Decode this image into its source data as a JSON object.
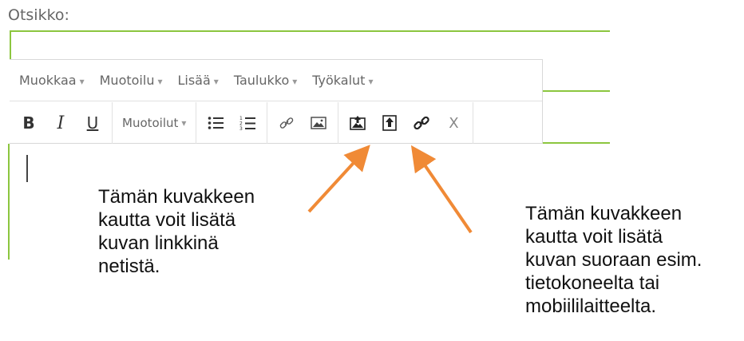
{
  "form": {
    "title_label": "Otsikko:"
  },
  "menubar": {
    "items": [
      {
        "label": "Muokkaa"
      },
      {
        "label": "Muotoilu"
      },
      {
        "label": "Lisää"
      },
      {
        "label": "Taulukko"
      },
      {
        "label": "Työkalut"
      }
    ],
    "caret": "▾"
  },
  "toolbar": {
    "bold": "B",
    "italic": "I",
    "underline": "U",
    "formats_label": "Muotoilut",
    "formats_caret": "▾",
    "close": "X",
    "icons": {
      "bullet_list": "bullet-list-icon",
      "numbered_list": "numbered-list-icon",
      "link": "link-icon",
      "image": "image-icon",
      "upload_image": "upload-image-icon",
      "upload_file": "upload-file-icon",
      "insert_link": "insert-link-icon"
    }
  },
  "annotations": {
    "left": "Tämän kuvakkeen\nkautta voit lisätä\nkuvan linkkinä\nnetistä.",
    "right": "Tämän kuvakkeen\nkautta voit lisätä\nkuvan suoraan esim.\ntietokoneelta tai\nmobiililaitteelta."
  },
  "colors": {
    "accent_green": "#8cc63f",
    "arrow_orange": "#f08a36"
  }
}
